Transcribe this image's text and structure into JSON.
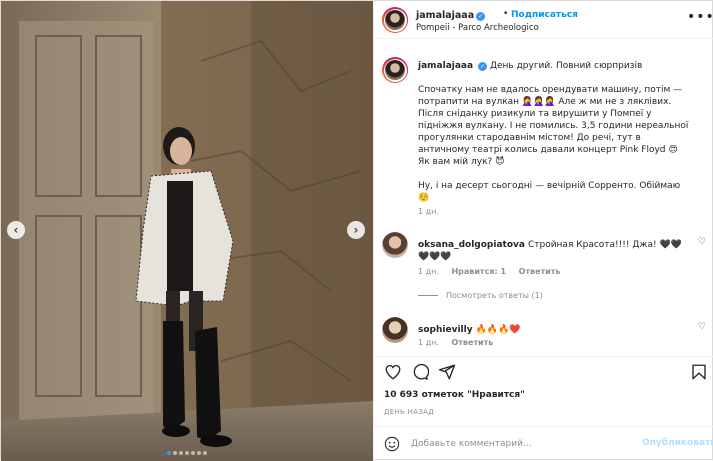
{
  "header": {
    "username": "jamalajaaa",
    "dot": "•",
    "follow_label": "Подписаться",
    "location": "Pompeii - Parco Archeologico"
  },
  "caption": {
    "username": "jamalajaaa",
    "headline": "День другий. Повний сюрпризів",
    "body": "Спочатку нам не вдалось орендувати машину, потім — потрапити на вулкан 🤦‍♀️🤦‍♀️🤦‍♀️ Але ж ми не з ляклівих. Після сніданку ризикули та вирушити у Помпеї у підніжжя вулкану. І не помились. 3,5 години нереальної прогулянки стародавнім містом! До речі, тут в античному театрі колись давали концерт Pink Floyd 😍",
    "question": "Як вам мій лук? 😈",
    "closing": "Ну, і на десерт сьогодні — вечірній Сорренто. Обіймаю ☺️",
    "time": "1 дн."
  },
  "comments": [
    {
      "username": "oksana_dolgopiatova",
      "text": "Стройная Красота!!!! Джа! 🖤🖤🖤🖤🖤",
      "time": "1 дн.",
      "likes": "Нравится: 1",
      "reply": "Ответить",
      "view_replies": "Посмотреть ответы (1)"
    },
    {
      "username": "sophievilly",
      "text": "🔥🔥🔥❤️",
      "time": "1 дн.",
      "reply": "Ответить"
    }
  ],
  "actions": {
    "likes_count": "10 693 отметок \"Нравится\"",
    "time_ago": "ДЕНЬ НАЗАД"
  },
  "add_comment": {
    "placeholder": "Добавьте комментарий...",
    "post_label": "Опубликовать"
  },
  "carousel": {
    "prev_icon": "‹",
    "next_icon": "›",
    "slide_count": 7,
    "active_slide": 1
  },
  "colors": {
    "accent": "#0095f6",
    "post_disabled": "#b2dffc",
    "verified": "#3897f0"
  }
}
